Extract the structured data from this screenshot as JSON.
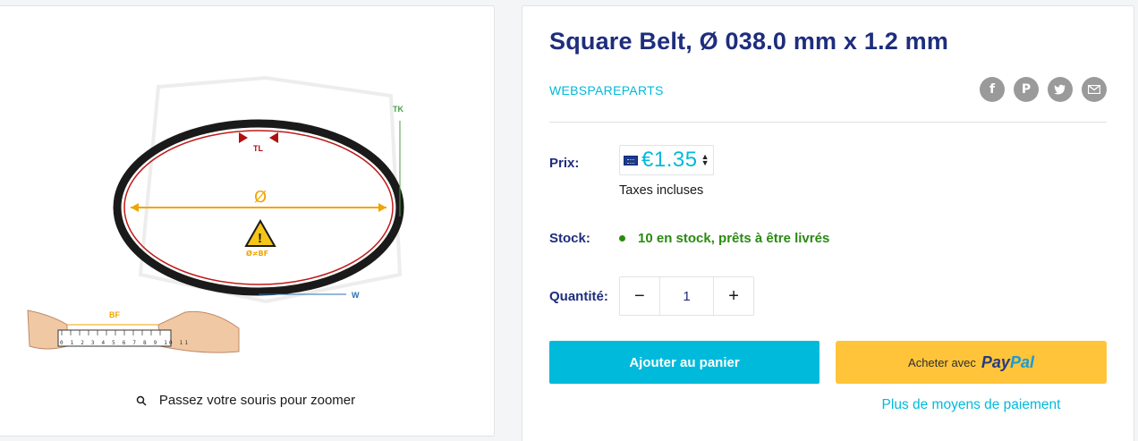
{
  "gallery": {
    "zoom_hint": "Passez votre souris pour zoomer",
    "diagram_labels": {
      "tk": "TK",
      "tl": "TL",
      "diameter": "Ø",
      "warning": "Ø≠BF",
      "w": "W",
      "bf": "BF",
      "ruler_numbers": "0 1 2 3 4 5 6 7 8 9 10 11"
    }
  },
  "product": {
    "title": "Square Belt, Ø 038.0 mm x 1.2 mm",
    "vendor": "WEBSPAREPARTS",
    "share_icons": [
      "facebook-icon",
      "pinterest-icon",
      "twitter-icon",
      "email-icon"
    ],
    "price_label": "Prix:",
    "currency_flag": "eu-flag-icon",
    "price": "€1.35",
    "tax_note": "Taxes incluses",
    "stock_label": "Stock:",
    "stock_status": "10 en stock, prêts à être livrés",
    "quantity_label": "Quantité:",
    "quantity_minus": "−",
    "quantity_value": "1",
    "quantity_plus": "+",
    "add_to_cart": "Ajouter au panier",
    "paypal_prefix": "Acheter avec",
    "paypal_brand_1": "Pay",
    "paypal_brand_2": "Pal",
    "more_payment": "Plus de moyens de paiement"
  },
  "colors": {
    "accent": "#00badb",
    "heading": "#1e2d7d",
    "stock_green": "#2a8a12",
    "paypal_yellow": "#ffc439"
  }
}
